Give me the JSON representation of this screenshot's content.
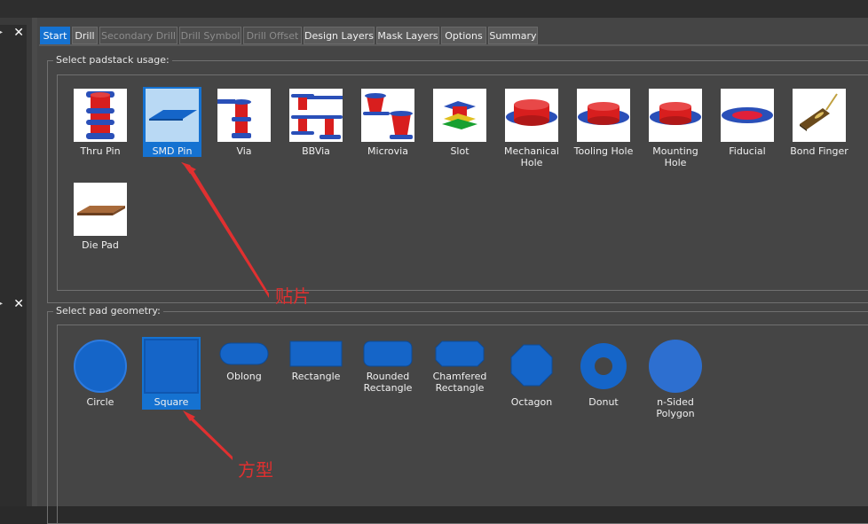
{
  "left_panels": [
    {
      "close_label": "✕",
      "pin_label": "▸"
    },
    {
      "close_label": "✕",
      "pin_label": "▸"
    }
  ],
  "tabs": [
    {
      "label": "Start",
      "state": "active"
    },
    {
      "label": "Drill",
      "state": "normal"
    },
    {
      "label": "Secondary Drill",
      "state": "disabled"
    },
    {
      "label": "Drill Symbol",
      "state": "disabled"
    },
    {
      "label": "Drill Offset",
      "state": "disabled"
    },
    {
      "label": "Design Layers",
      "state": "normal"
    },
    {
      "label": "Mask Layers",
      "state": "normal"
    },
    {
      "label": "Options",
      "state": "normal"
    },
    {
      "label": "Summary",
      "state": "normal"
    }
  ],
  "usage_group": {
    "title": "Select padstack usage:",
    "selected": "SMD Pin",
    "items": [
      {
        "label": "Thru Pin",
        "icon": "thru-pin-icon"
      },
      {
        "label": "SMD Pin",
        "icon": "smd-pin-icon"
      },
      {
        "label": "Via",
        "icon": "via-icon"
      },
      {
        "label": "BBVia",
        "icon": "bbvia-icon"
      },
      {
        "label": "Microvia",
        "icon": "microvia-icon"
      },
      {
        "label": "Slot",
        "icon": "slot-icon"
      },
      {
        "label": "Mechanical Hole",
        "icon": "mechanical-hole-icon"
      },
      {
        "label": "Tooling Hole",
        "icon": "tooling-hole-icon"
      },
      {
        "label": "Mounting Hole",
        "icon": "mounting-hole-icon"
      },
      {
        "label": "Fiducial",
        "icon": "fiducial-icon"
      },
      {
        "label": "Bond Finger",
        "icon": "bond-finger-icon"
      },
      {
        "label": "Die Pad",
        "icon": "die-pad-icon"
      }
    ]
  },
  "geometry_group": {
    "title": "Select pad geometry:",
    "selected": "Square",
    "items": [
      {
        "label": "Circle",
        "icon": "circle-icon"
      },
      {
        "label": "Square",
        "icon": "square-icon"
      },
      {
        "label": "Oblong",
        "icon": "oblong-icon"
      },
      {
        "label": "Rectangle",
        "icon": "rectangle-icon"
      },
      {
        "label": "Rounded Rectangle",
        "icon": "rounded-rectangle-icon"
      },
      {
        "label": "Chamfered Rectangle",
        "icon": "chamfered-rectangle-icon"
      },
      {
        "label": "Octagon",
        "icon": "octagon-icon"
      },
      {
        "label": "Donut",
        "icon": "donut-icon"
      },
      {
        "label": "n-Sided Polygon",
        "icon": "n-sided-polygon-icon"
      }
    ]
  },
  "annotations": {
    "smd_note": "贴片",
    "square_note": "方型"
  },
  "colors": {
    "accent": "#1572d1",
    "pad_blue": "#1565c8",
    "annotation_red": "#e03030",
    "copper_red": "#d81e1e"
  }
}
